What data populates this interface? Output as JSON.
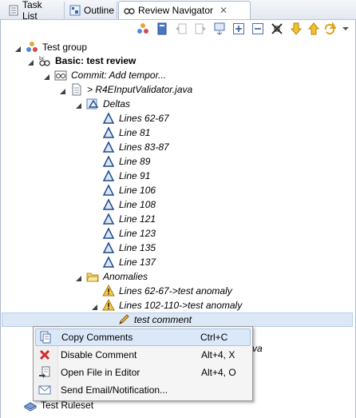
{
  "tabs": [
    {
      "label": "Task List",
      "icon": "task-list-icon"
    },
    {
      "label": "Outline",
      "icon": "outline-icon"
    },
    {
      "label": "Review Navigator",
      "icon": "review-navigator-icon"
    }
  ],
  "toolbar": {
    "buttons": [
      "show-tree-icon",
      "document-icon",
      "back-icon",
      "forward-icon",
      "link-editor-icon",
      "expand-all-icon",
      "collapse-all-icon",
      "filter-icon",
      "down-arrow-icon",
      "up-arrow-icon",
      "refresh-icon",
      "view-menu-icon"
    ]
  },
  "tree": {
    "group": "Test group",
    "review": "Basic: test review",
    "commit": "Commit: Add tempor...",
    "file": "> R4EInputValidator.java",
    "deltas_label": "Deltas",
    "deltas": [
      "Lines 62-67",
      "Line 81",
      "Lines 83-87",
      "Line 89",
      "Line 91",
      "Line 106",
      "Line 108",
      "Line 121",
      "Line 123",
      "Line 135",
      "Line 137"
    ],
    "anomalies_label": "Anomalies",
    "anomalies": [
      "Lines 62-67->test anomaly",
      "Lines 102-110->test anomaly"
    ],
    "comment": "test comment",
    "hidden_partial": "va",
    "ruleset": "Test Ruleset"
  },
  "menu": {
    "items": [
      {
        "label": "Copy Comments",
        "shortcut": "Ctrl+C",
        "icon": "copy-icon"
      },
      {
        "label": "Disable Comment",
        "shortcut": "Alt+4, X",
        "icon": "disable-icon"
      },
      {
        "label": "Open File in Editor",
        "shortcut": "Alt+4, O",
        "icon": "open-file-icon"
      },
      {
        "label": "Send Email/Notification...",
        "shortcut": "",
        "icon": "email-icon"
      }
    ]
  }
}
